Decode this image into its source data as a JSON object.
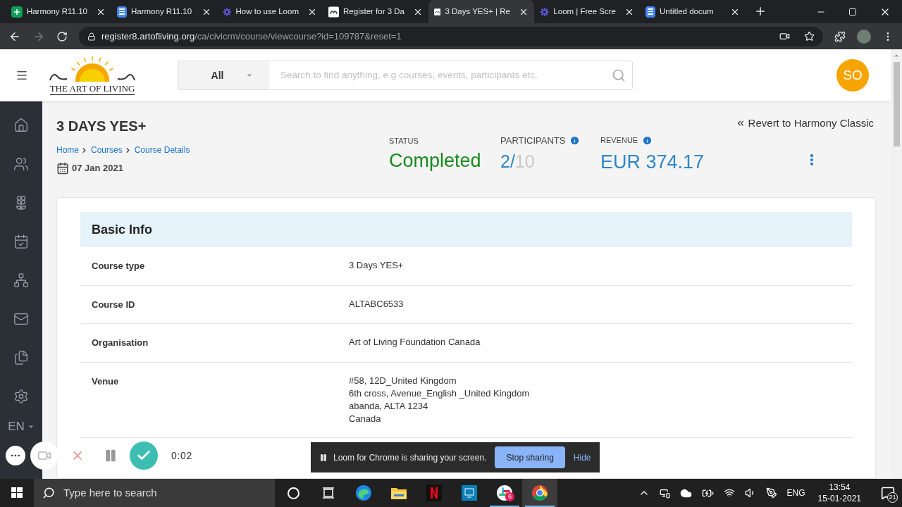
{
  "browser": {
    "tabs": [
      {
        "title": "Harmony R11.10",
        "kind": "sheets",
        "selected": false
      },
      {
        "title": "Harmony R11.10",
        "kind": "docs",
        "selected": false
      },
      {
        "title": "How to use Loom",
        "kind": "loom",
        "selected": false
      },
      {
        "title": "Register for 3 Da",
        "kind": "site",
        "selected": false
      },
      {
        "title": "3 Days YES+ | Re",
        "kind": "site",
        "selected": true
      },
      {
        "title": "Loom | Free Scre",
        "kind": "loom",
        "selected": false
      },
      {
        "title": "Untitled docum",
        "kind": "docs",
        "selected": false
      }
    ],
    "url": {
      "host": "register8.artofliving.org",
      "path": "/ca/civicrm/course/viewcourse?id=109787&reset=1"
    }
  },
  "header": {
    "logo_text": "THE ART OF LIVING",
    "search": {
      "scope": "All",
      "placeholder": "Search to find anything, e.g courses, events, participants etc."
    },
    "avatar": "SO"
  },
  "sidebar": {
    "language": "EN"
  },
  "course": {
    "title": "3 DAYS YES+",
    "breadcrumbs": [
      "Home",
      "Courses",
      "Course Details"
    ],
    "date": "07 Jan 2021",
    "revert_link": "Revert to Harmony Classic",
    "status": {
      "label": "STATUS",
      "value": "Completed"
    },
    "participants": {
      "label": "PARTICIPANTS",
      "count": "2",
      "separator": "/",
      "total": "10"
    },
    "revenue": {
      "label": "REVENUE",
      "value": "EUR 374.17"
    }
  },
  "basic_info": {
    "title": "Basic Info",
    "rows": [
      {
        "label": "Course type",
        "lines": [
          "3 Days YES+"
        ]
      },
      {
        "label": "Course ID",
        "lines": [
          "ALTABC6533"
        ]
      },
      {
        "label": "Organisation",
        "lines": [
          "Art of Living Foundation Canada"
        ]
      },
      {
        "label": "Venue",
        "lines": [
          "#58, 12D_United Kingdom",
          "6th cross, Avenue_English _United Kingdom",
          "abanda, ALTA 1234",
          "Canada"
        ]
      }
    ]
  },
  "loom": {
    "timer": "0:02",
    "notice": "Loom for Chrome is sharing your screen.",
    "stop_button": "Stop sharing",
    "hide_link": "Hide"
  },
  "taskbar": {
    "search_placeholder": "Type here to search",
    "apps": [
      {
        "kind": "cortana",
        "running": false,
        "selected": false
      },
      {
        "kind": "taskview",
        "running": false,
        "selected": false
      },
      {
        "kind": "edge",
        "running": false,
        "selected": false
      },
      {
        "kind": "files",
        "running": false,
        "selected": false
      },
      {
        "kind": "netflix",
        "running": false,
        "selected": false
      },
      {
        "kind": "remote",
        "running": false,
        "selected": false
      },
      {
        "kind": "slack",
        "running": true,
        "selected": false,
        "badge": "6"
      },
      {
        "kind": "chrome",
        "running": true,
        "selected": true
      }
    ],
    "language": "ENG",
    "time": "13:54",
    "date": "15-01-2021",
    "notifications": "21"
  }
}
